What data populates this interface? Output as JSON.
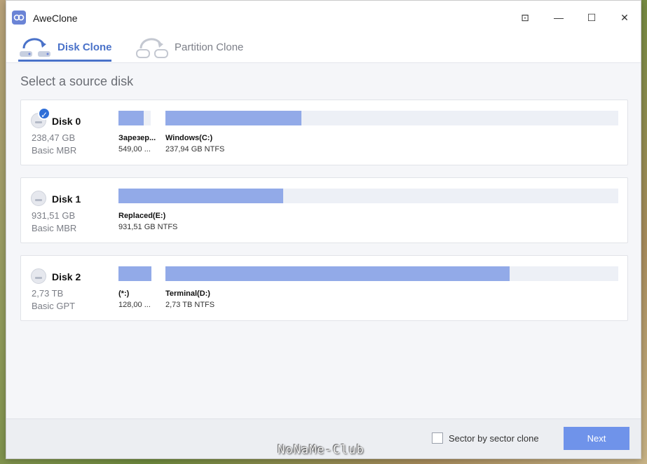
{
  "app": {
    "title": "AweClone"
  },
  "window_controls": {
    "pin_glyph": "⊡",
    "minimize_glyph": "—",
    "maximize_glyph": "☐",
    "close_glyph": "✕"
  },
  "tabs": [
    {
      "label": "Disk Clone",
      "active": true,
      "icon": "disk-clone-icon"
    },
    {
      "label": "Partition Clone",
      "active": false,
      "icon": "partition-clone-icon"
    }
  ],
  "page_title": "Select a source disk",
  "disks": [
    {
      "name": "Disk 0",
      "size": "238,47 GB",
      "type": "Basic MBR",
      "selected": true,
      "partitions": [
        {
          "name": "Зарезер...",
          "info": "549,00 ...",
          "used_fraction": 0.78
        },
        {
          "name": "Windows(C:)",
          "info": "237,94 GB NTFS",
          "used_fraction": 0.3
        }
      ]
    },
    {
      "name": "Disk 1",
      "size": "931,51 GB",
      "type": "Basic MBR",
      "selected": false,
      "partitions": [
        {
          "name": "Replaced(E:)",
          "info": "931,51 GB NTFS",
          "used_fraction": 0.33
        }
      ]
    },
    {
      "name": "Disk 2",
      "size": "2,73 TB",
      "type": "Basic GPT",
      "selected": false,
      "partitions": [
        {
          "name": "(*:)",
          "info": "128,00 ...",
          "used_fraction": 1.0
        },
        {
          "name": "Terminal(D:)",
          "info": "2,73 TB NTFS",
          "used_fraction": 0.76
        }
      ]
    }
  ],
  "footer": {
    "sector_clone_label": "Sector by sector clone",
    "sector_clone_checked": false,
    "next_label": "Next"
  },
  "watermark": "NoNaMe-Club",
  "colors": {
    "accent": "#4a72c9",
    "bar_fill": "#92aae8",
    "bar_track": "#edf0f6",
    "next_button": "#6f93ea",
    "check_badge": "#2f6fd8"
  }
}
